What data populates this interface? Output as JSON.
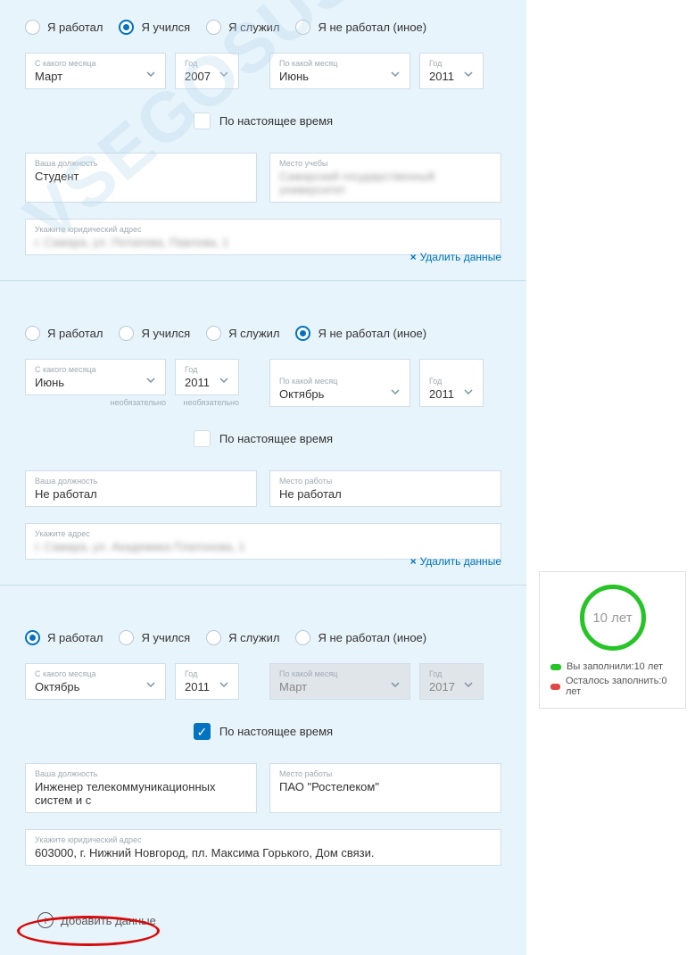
{
  "labels": {
    "from_month": "С какого месяца",
    "year": "Год",
    "to_month": "По какой месяц",
    "position": "Ваша должность",
    "study_place": "Место учебы",
    "work_place": "Место работы",
    "legal_address": "Укажите юридический адрес",
    "address": "Укажите адрес",
    "present": "По настоящее время",
    "delete": "Удалить данные",
    "add": "Добавить данные",
    "optional": "необязательно"
  },
  "radios": {
    "worked": "Я работал",
    "studied": "Я учился",
    "served": "Я служил",
    "none": "Я не работал (иное)"
  },
  "sections": [
    {
      "selected_radio": "studied",
      "from_month": "Март",
      "from_year": "2007",
      "to_month": "Июнь",
      "to_year": "2011",
      "present": false,
      "position": "Студент",
      "place_label": "study_place",
      "place_value": "Самарский государственный университет",
      "address_label": "legal_address",
      "address_value": "г. Самара, ул. Потапова, Павлова, 1",
      "show_delete": false,
      "show_optional": false,
      "to_disabled": false,
      "blur_place": true,
      "blur_address": true
    },
    {
      "selected_radio": "none",
      "from_month": "Июнь",
      "from_year": "2011",
      "to_month": "Октябрь",
      "to_year": "2011",
      "present": false,
      "position": "Не работал",
      "place_label": "work_place",
      "place_value": "Не работал",
      "address_label": "address",
      "address_value": "г. Самара, ул. Академика Платонова, 1",
      "show_delete": true,
      "show_optional": true,
      "to_disabled": false,
      "blur_place": false,
      "blur_address": true
    },
    {
      "selected_radio": "worked",
      "from_month": "Октябрь",
      "from_year": "2011",
      "to_month": "Март",
      "to_year": "2017",
      "present": true,
      "position": "Инженер телекоммуникационных систем и с",
      "place_label": "work_place",
      "place_value": "ПАО \"Ростелеком\"",
      "address_label": "legal_address",
      "address_value": "603000, г. Нижний Новгород, пл. Максима Горького, Дом связи.",
      "show_delete": true,
      "show_optional": false,
      "to_disabled": true,
      "blur_place": false,
      "blur_address": false
    }
  ],
  "side": {
    "ring_text": "10 лет",
    "filled_label": "Вы заполнили:",
    "filled_value": "10 лет",
    "remain_label": "Осталось заполнить:",
    "remain_value": "0 лет"
  },
  "watermark": "VSEGOSUSLUGI.RU"
}
